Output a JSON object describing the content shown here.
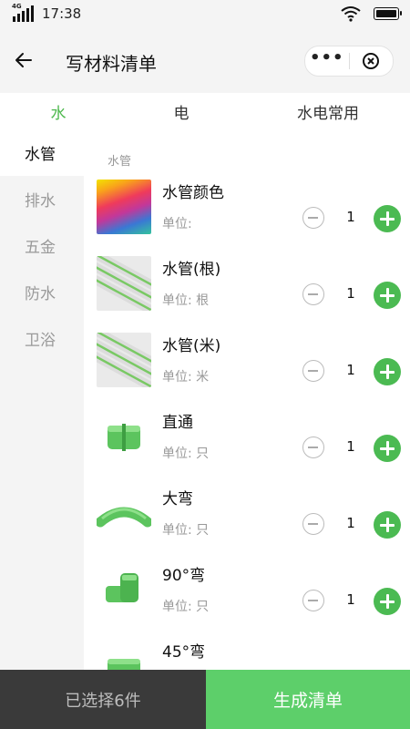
{
  "status": {
    "network": "4G",
    "time": "17:38"
  },
  "header": {
    "title": "写材料清单"
  },
  "tabs": [
    {
      "label": "水",
      "active": true
    },
    {
      "label": "电",
      "active": false
    },
    {
      "label": "水电常用",
      "active": false
    }
  ],
  "sidebar": {
    "items": [
      {
        "label": "水管",
        "active": true
      },
      {
        "label": "排水",
        "active": false
      },
      {
        "label": "五金",
        "active": false
      },
      {
        "label": "防水",
        "active": false
      },
      {
        "label": "卫浴",
        "active": false
      }
    ]
  },
  "section_title": "水管",
  "items": [
    {
      "name": "水管颜色",
      "unit": "单位:",
      "qty": "1",
      "thumb": "color-swatch"
    },
    {
      "name": "水管(根)",
      "unit": "单位: 根",
      "qty": "1",
      "thumb": "pipes"
    },
    {
      "name": "水管(米)",
      "unit": "单位: 米",
      "qty": "1",
      "thumb": "pipes"
    },
    {
      "name": "直通",
      "unit": "单位: 只",
      "qty": "1",
      "thumb": "straight-coupling"
    },
    {
      "name": "大弯",
      "unit": "单位: 只",
      "qty": "1",
      "thumb": "large-bend"
    },
    {
      "name": "90°弯",
      "unit": "单位: 只",
      "qty": "1",
      "thumb": "elbow-90"
    },
    {
      "name": "45°弯",
      "unit": "",
      "qty": "",
      "thumb": "elbow-45"
    }
  ],
  "bottom": {
    "selected_label": "已选择6件",
    "generate_label": "生成清单"
  },
  "colors": {
    "accent": "#4bba52",
    "generate_bg": "#5dcf6a",
    "bottom_dark": "#3a3a3a"
  }
}
